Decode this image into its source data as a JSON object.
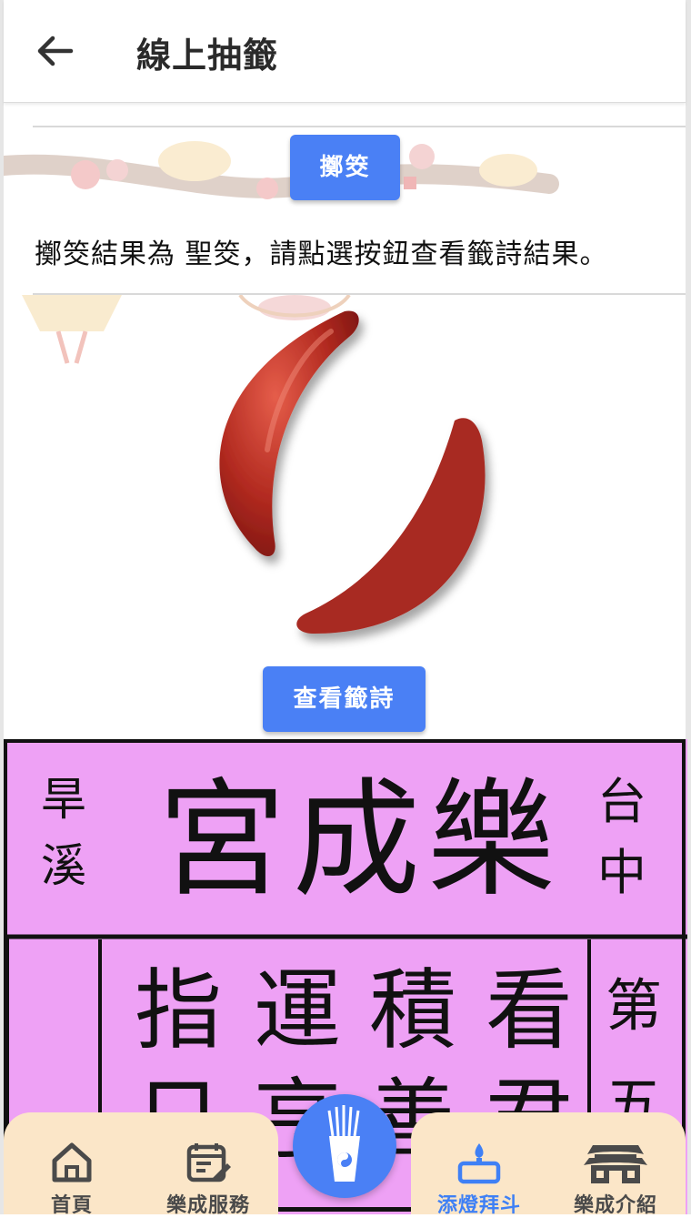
{
  "header": {
    "title": "線上抽籤"
  },
  "throw": {
    "button_label": "擲筊",
    "result_text": "擲筊結果為 聖筊，請點選按鈕查看籤詩結果。"
  },
  "view_poem_button": "查看籤詩",
  "plaque": {
    "left_text": "旱溪",
    "title": "宮成樂",
    "right_text": "台中",
    "poem_row1": [
      "指",
      "運",
      "積",
      "看"
    ],
    "poem_row2": [
      "日",
      "亨",
      "善",
      "君"
    ],
    "side_text": [
      "第",
      "五"
    ],
    "background_color": "#eea1f5"
  },
  "bottom_nav": {
    "items": [
      {
        "label": "首頁",
        "icon": "home-icon"
      },
      {
        "label": "樂成服務",
        "icon": "calendar-edit-icon"
      },
      {
        "label": "添燈拜斗",
        "icon": "lamp-icon",
        "active": true
      },
      {
        "label": "樂成介紹",
        "icon": "temple-icon"
      }
    ],
    "center_icon": "fortune-sticks-icon",
    "active_color": "#3f80f5",
    "panel_color": "#fbe6c8"
  },
  "colors": {
    "primary": "#4a80f5",
    "jiao_red": "#a82a22"
  }
}
